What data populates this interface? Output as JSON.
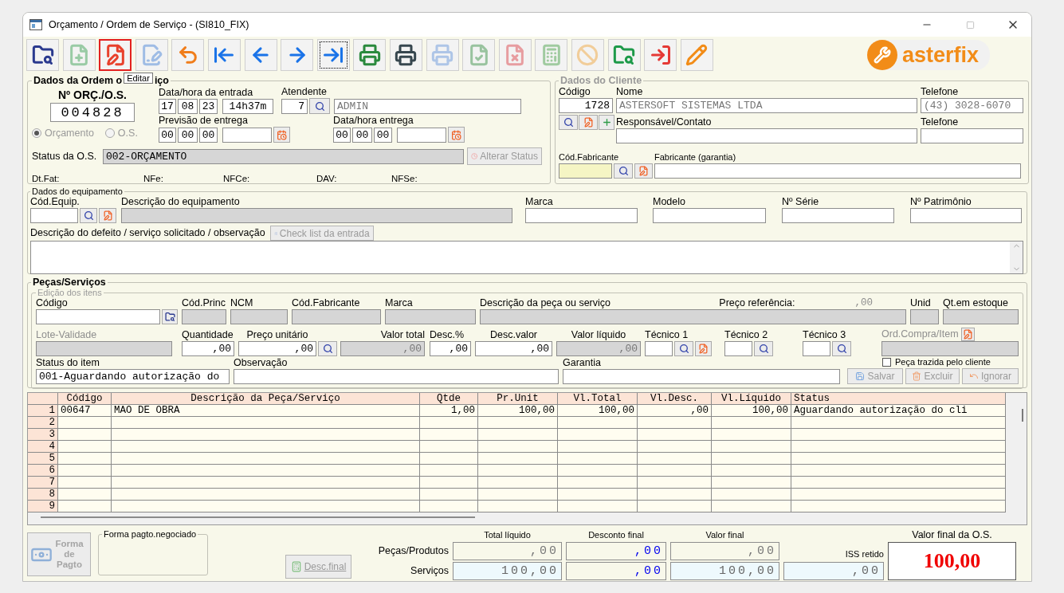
{
  "window": {
    "title": "Orçamento / Ordem de Serviço - (SI810_FIX)"
  },
  "toolbar": {
    "buttons": [
      {
        "kind": "search-folder",
        "selected": false,
        "disabled": false,
        "focused": false
      },
      {
        "kind": "add-document",
        "selected": false,
        "disabled": true,
        "focused": false
      },
      {
        "kind": "edit-document",
        "selected": true,
        "disabled": false,
        "focused": false
      },
      {
        "kind": "edit-record",
        "selected": false,
        "disabled": true,
        "focused": false
      },
      {
        "kind": "undo",
        "selected": false,
        "disabled": false,
        "focused": false
      },
      {
        "kind": "first",
        "selected": false,
        "disabled": false,
        "focused": false
      },
      {
        "kind": "previous",
        "selected": false,
        "disabled": false,
        "focused": false
      },
      {
        "kind": "next",
        "selected": false,
        "disabled": false,
        "focused": false
      },
      {
        "kind": "last",
        "selected": false,
        "disabled": false,
        "focused": true
      },
      {
        "kind": "print",
        "selected": false,
        "disabled": false,
        "focused": false
      },
      {
        "kind": "print-dark",
        "selected": false,
        "disabled": false,
        "focused": false
      },
      {
        "kind": "print-light",
        "selected": false,
        "disabled": true,
        "focused": false
      },
      {
        "kind": "document-check",
        "selected": false,
        "disabled": true,
        "focused": false
      },
      {
        "kind": "document-cancel",
        "selected": false,
        "disabled": true,
        "focused": false
      },
      {
        "kind": "cash-add",
        "selected": false,
        "disabled": true,
        "focused": false
      },
      {
        "kind": "cash-cancel",
        "selected": false,
        "disabled": true,
        "focused": false
      },
      {
        "kind": "folder-search",
        "selected": false,
        "disabled": false,
        "focused": false
      },
      {
        "kind": "exit",
        "selected": false,
        "disabled": false,
        "focused": false
      },
      {
        "kind": "pencil",
        "selected": false,
        "disabled": false,
        "focused": false
      }
    ],
    "tooltip": "Editar",
    "logo": "asterfix"
  },
  "order": {
    "legend_start": "Dados da Ordem o",
    "legend_end": "iço",
    "number_label": "Nº ORÇ./O.S.",
    "number": "004828",
    "types": [
      {
        "label": "Orçamento",
        "selected": true
      },
      {
        "label": "O.S.",
        "selected": false
      }
    ],
    "entry": {
      "label": "Data/hora da entrada",
      "day": "17",
      "month": "08",
      "year": "23",
      "time": "14h37m"
    },
    "attendant": {
      "label": "Atendente",
      "code": "7",
      "name": "ADMIN"
    },
    "forecast": {
      "label": "Previsão de entrega",
      "day": "00",
      "month": "00",
      "year": "00"
    },
    "delivery": {
      "label": "Data/hora entrega",
      "day": "00",
      "month": "00",
      "year": "00"
    },
    "status": {
      "label": "Status da O.S.",
      "value": "002-ORÇAMENTO",
      "button": "Alterar Status",
      "button_disabled": true
    },
    "docs": [
      "Dt.Fat:",
      "NFe:",
      "NFCe:",
      "DAV:",
      "NFSe:"
    ]
  },
  "client": {
    "legend": "Dados do Cliente",
    "code_label": "Código",
    "code": "1728",
    "name_label": "Nome",
    "name": "ASTERSOFT SISTEMAS LTDA",
    "phone_label": "Telefone",
    "phone": "(43) 3028-6070",
    "contact_label": "Responsável/Contato",
    "phone2_label": "Telefone",
    "maker_code_label": "Cód.Fabricante",
    "maker_label": "Fabricante (garantia)"
  },
  "equipment": {
    "legend": "Dados do equipamento",
    "fields": [
      {
        "label": "Cód.Equip.",
        "readonly": false
      },
      {
        "label": "Descrição do equipamento",
        "readonly": true
      },
      {
        "label": "Marca",
        "readonly": false
      },
      {
        "label": "Modelo",
        "readonly": false
      },
      {
        "label": "Nº Série",
        "readonly": false
      },
      {
        "label": "Nº Patrimônio",
        "readonly": false
      }
    ],
    "defect_label": "Descrição do defeito / serviço solicitado / observação",
    "checklist_button": "Check list da entrada",
    "checklist_disabled": true
  },
  "parts": {
    "legend": "Peças/Serviços",
    "sublegend": "Edição dos itens",
    "row1": [
      {
        "label": "Código",
        "readonly": false
      },
      {
        "label": "Cód.Princ",
        "readonly": true
      },
      {
        "label": "NCM",
        "readonly": true
      },
      {
        "label": "Cód.Fabricante",
        "readonly": true
      },
      {
        "label": "Marca",
        "readonly": true
      },
      {
        "label": "Descrição da peça ou serviço",
        "readonly": true
      },
      {
        "label": "Unid",
        "readonly": true
      },
      {
        "label": "Qt.em estoque",
        "readonly": true
      }
    ],
    "reference": {
      "label": "Preço referência:",
      "value": ",00"
    },
    "row2": [
      {
        "label": "Lote-Validade",
        "readonly": true,
        "disabled": true
      },
      {
        "label": "Quantidade",
        "value": ",00",
        "readonly": false,
        "disabled": false
      },
      {
        "label": "Preço unitário",
        "value": ",00",
        "readonly": false,
        "disabled": false
      },
      {
        "label": "Valor total",
        "value": ",00",
        "readonly": true,
        "disabled": false
      },
      {
        "label": "Desc.%",
        "value": ",00",
        "readonly": false,
        "disabled": false
      },
      {
        "label": "Desc.valor",
        "value": ",00",
        "readonly": false,
        "disabled": false
      },
      {
        "label": "Valor líquido",
        "value": ",00",
        "readonly": true,
        "disabled": false
      },
      {
        "label": "Técnico 1",
        "readonly": false,
        "disabled": false
      },
      {
        "label": "Técnico 2",
        "readonly": false,
        "disabled": false
      },
      {
        "label": "Técnico 3",
        "readonly": false,
        "disabled": false
      },
      {
        "label": "Ord.Compra/Item",
        "readonly": true,
        "disabled": true
      }
    ],
    "row3": [
      {
        "label": "Status do item",
        "value": "001-Aguardando autorização do"
      },
      {
        "label": "Observação"
      },
      {
        "label": "Garantia"
      }
    ],
    "brought_by_client": {
      "label": "Peça trazida pelo cliente",
      "checked": false
    },
    "buttons": [
      {
        "label": "Salvar",
        "kind": "save",
        "disabled": true
      },
      {
        "label": "Excluir",
        "kind": "delete",
        "disabled": true
      },
      {
        "label": "Ignorar",
        "kind": "ignore",
        "disabled": true
      }
    ]
  },
  "table": {
    "columns": [
      "Código",
      "Descrição da Peça/Serviço",
      "Qtde",
      "Pr.Unit",
      "Vl.Total",
      "Vl.Desc.",
      "Vl.Líquido",
      "Status"
    ],
    "rows": [
      {
        "number": "1",
        "cells": [
          "00647",
          "MAO DE OBRA",
          "1,00",
          "100,00",
          "100,00",
          ",00",
          "100,00",
          "Aguardando autorização do cli"
        ]
      },
      {
        "number": "2"
      },
      {
        "number": "3"
      },
      {
        "number": "4"
      },
      {
        "number": "5"
      },
      {
        "number": "6"
      },
      {
        "number": "7"
      },
      {
        "number": "8"
      },
      {
        "number": "9"
      }
    ]
  },
  "footer": {
    "payment_button": "Forma de Pagto",
    "payment_disabled": true,
    "negotiated": "Forma pagto.negociado",
    "discount_button": "Desc.final",
    "discount_disabled": true,
    "columns": [
      "Total líquido",
      "Desconto final",
      "Valor final"
    ],
    "rows": [
      {
        "label": "Peças/Produtos",
        "values": [
          ",00",
          ",00",
          ",00"
        ]
      },
      {
        "label": "Serviços",
        "values": [
          "100,00",
          ",00",
          "100,00"
        ]
      }
    ],
    "iss": {
      "label": "ISS retido",
      "value": ",00"
    },
    "total": {
      "label": "Valor final da O.S.",
      "value": "100,00"
    }
  }
}
